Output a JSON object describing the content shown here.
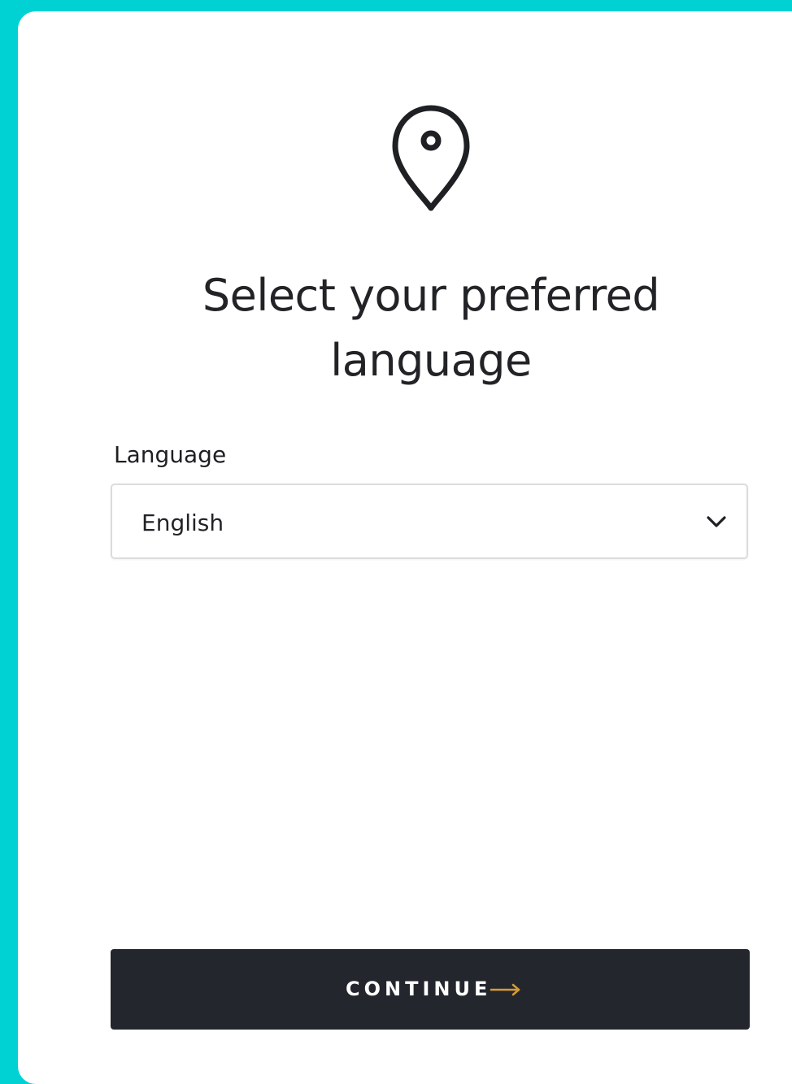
{
  "page": {
    "title": "Select your preferred language"
  },
  "language_field": {
    "label": "Language",
    "selected_value": "English"
  },
  "continue_button": {
    "label": "CONTINUE"
  },
  "icons": {
    "header": "location-pin-icon",
    "select": "chevron-down-icon",
    "button": "arrow-right-icon"
  },
  "colors": {
    "background_accent": "#00d2d3",
    "button_background": "#24262d",
    "arrow_accent": "#d49a3a",
    "text_primary": "#222326"
  }
}
